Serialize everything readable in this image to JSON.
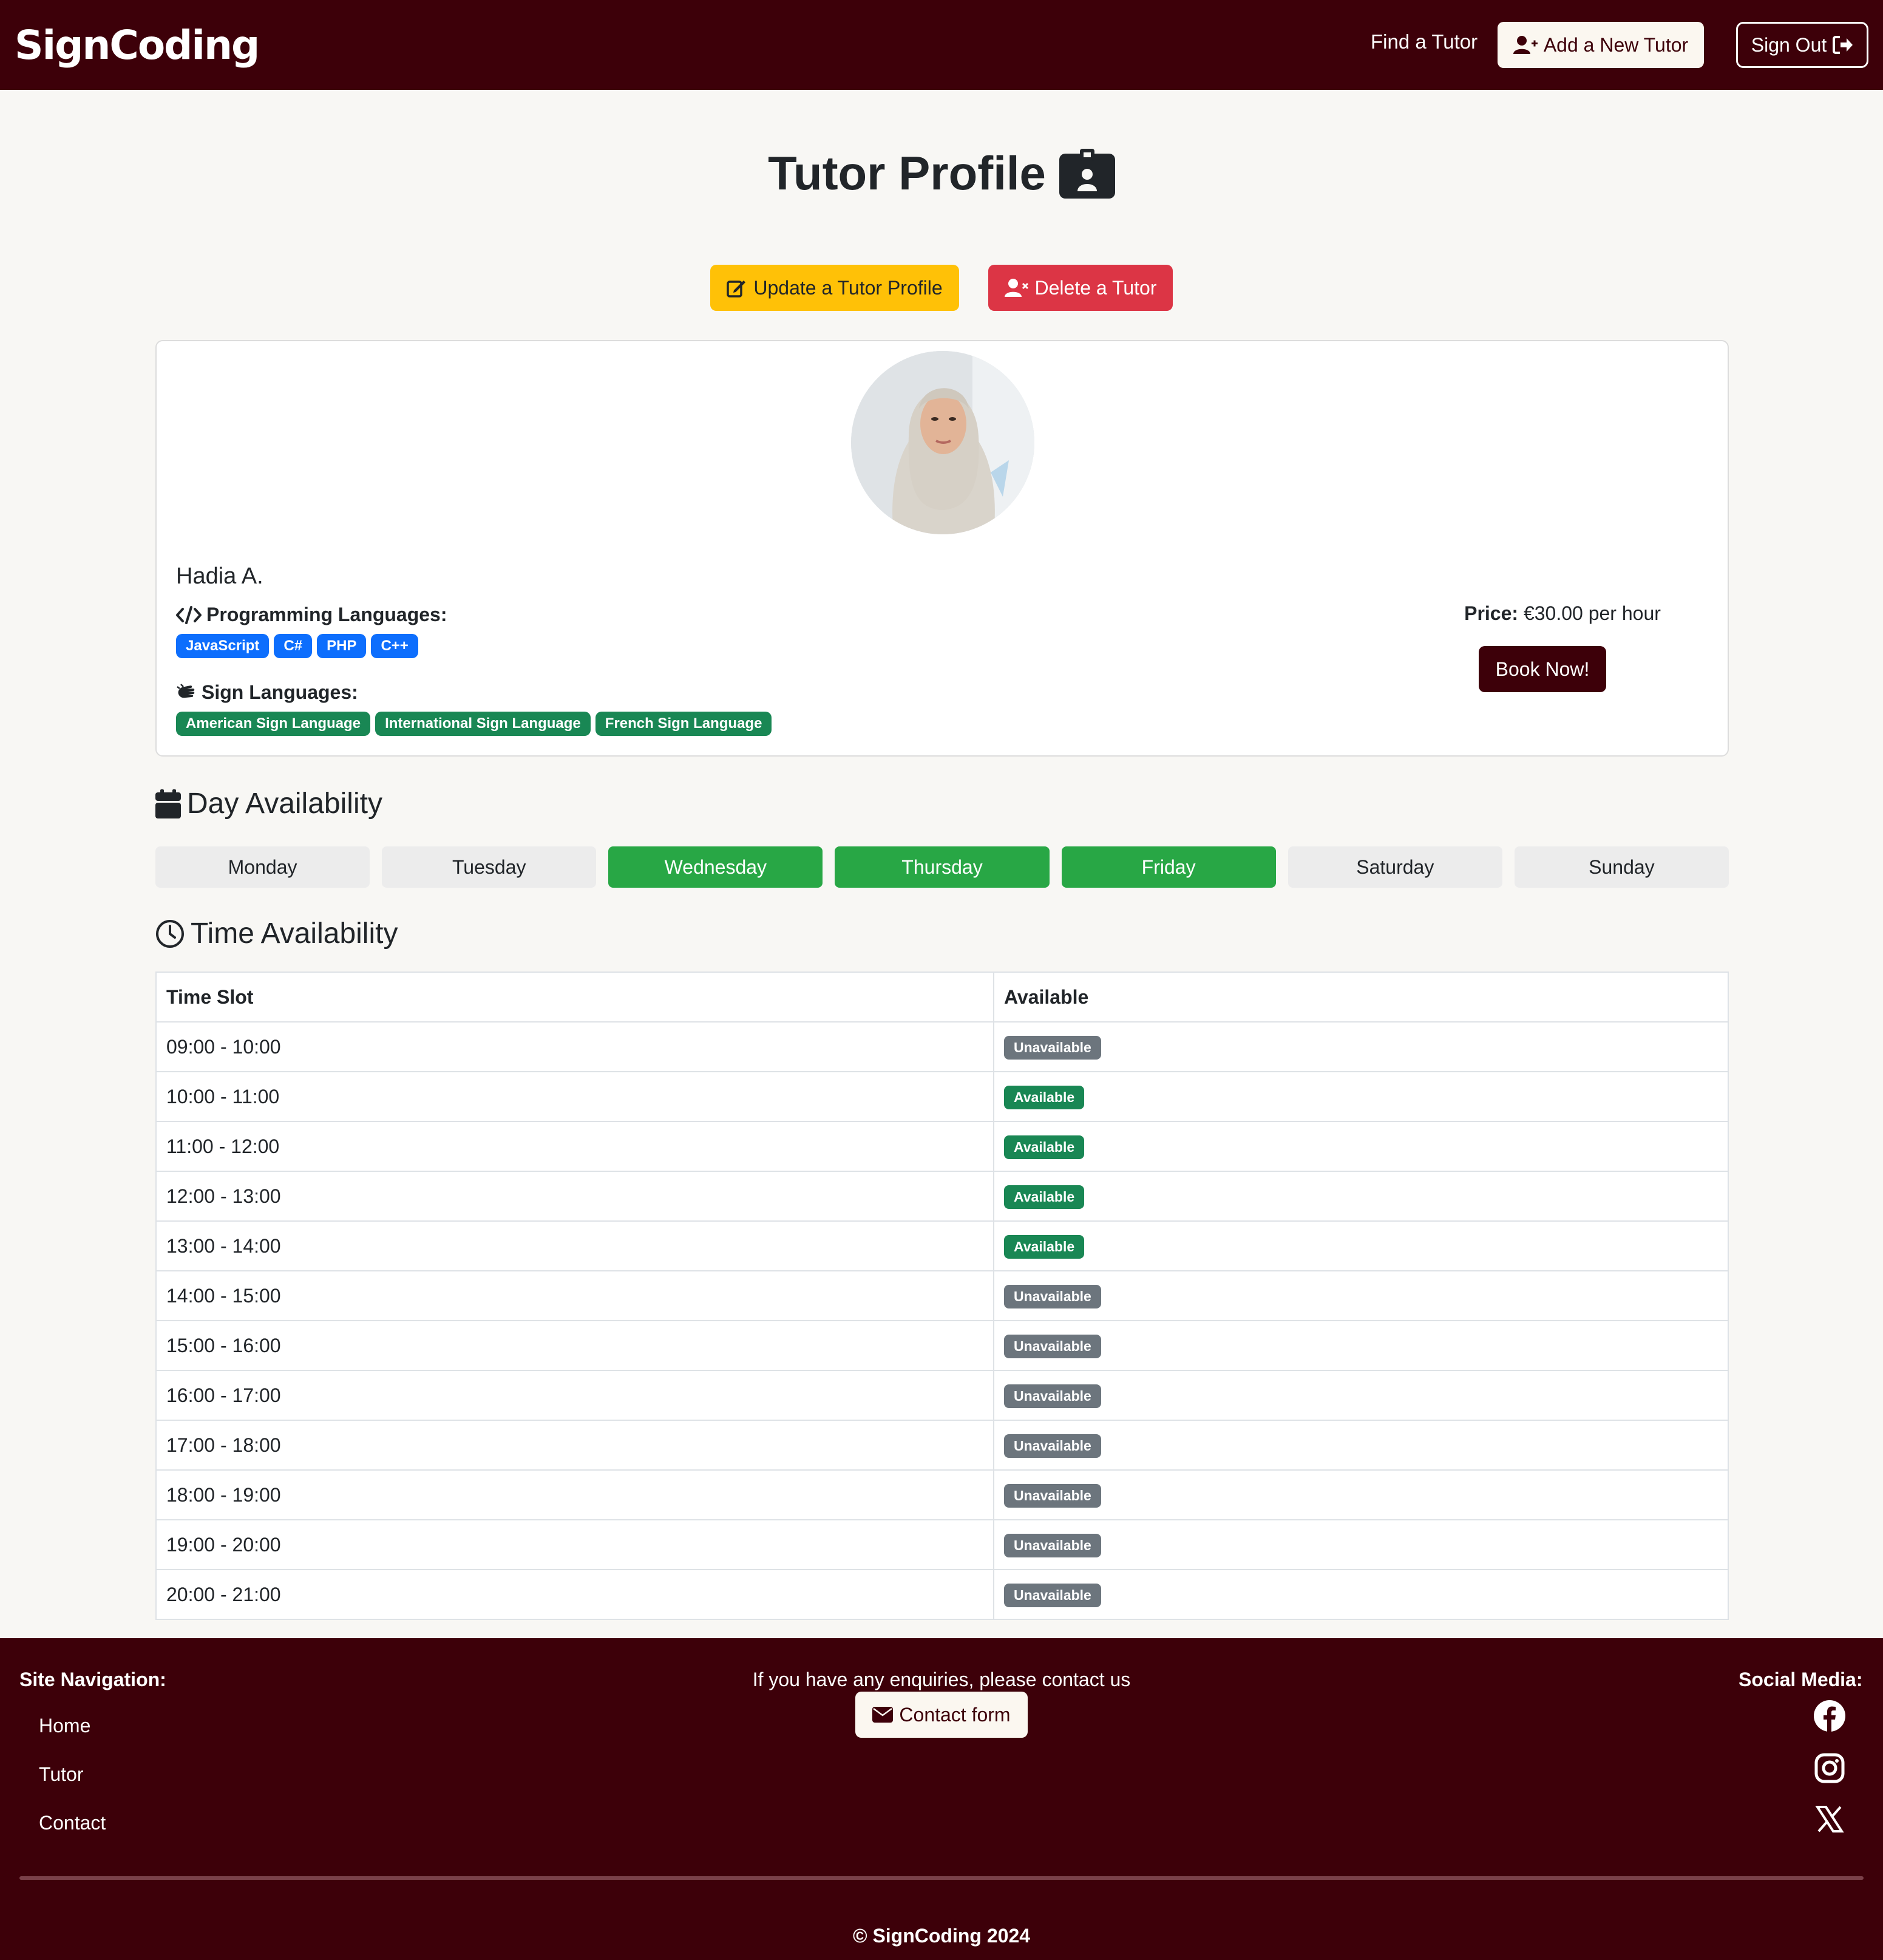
{
  "header": {
    "brand": "SignCoding",
    "find_tutor": "Find a Tutor",
    "add_tutor": "Add a New Tutor",
    "sign_out": "Sign Out"
  },
  "page": {
    "title": "Tutor Profile",
    "update_button": "Update a Tutor Profile",
    "delete_button": "Delete a Tutor"
  },
  "tutor": {
    "name": "Hadia A.",
    "programming_label": "Programming Languages:",
    "programming_languages": [
      "JavaScript",
      "C#",
      "PHP",
      "C++"
    ],
    "sign_label": "Sign Languages:",
    "sign_languages": [
      "American Sign Language",
      "International Sign Language",
      "French Sign Language"
    ],
    "price_label": "Price:",
    "price_value": "€30.00 per hour",
    "book_button": "Book Now!"
  },
  "day_availability": {
    "heading": "Day Availability",
    "days": [
      {
        "label": "Monday",
        "available": false
      },
      {
        "label": "Tuesday",
        "available": false
      },
      {
        "label": "Wednesday",
        "available": true
      },
      {
        "label": "Thursday",
        "available": true
      },
      {
        "label": "Friday",
        "available": true
      },
      {
        "label": "Saturday",
        "available": false
      },
      {
        "label": "Sunday",
        "available": false
      }
    ]
  },
  "time_availability": {
    "heading": "Time Availability",
    "columns": [
      "Time Slot",
      "Available"
    ],
    "rows": [
      {
        "slot": "09:00 - 10:00",
        "status": "Unavailable"
      },
      {
        "slot": "10:00 - 11:00",
        "status": "Available"
      },
      {
        "slot": "11:00 - 12:00",
        "status": "Available"
      },
      {
        "slot": "12:00 - 13:00",
        "status": "Available"
      },
      {
        "slot": "13:00 - 14:00",
        "status": "Available"
      },
      {
        "slot": "14:00 - 15:00",
        "status": "Unavailable"
      },
      {
        "slot": "15:00 - 16:00",
        "status": "Unavailable"
      },
      {
        "slot": "16:00 - 17:00",
        "status": "Unavailable"
      },
      {
        "slot": "17:00 - 18:00",
        "status": "Unavailable"
      },
      {
        "slot": "18:00 - 19:00",
        "status": "Unavailable"
      },
      {
        "slot": "19:00 - 20:00",
        "status": "Unavailable"
      },
      {
        "slot": "20:00 - 21:00",
        "status": "Unavailable"
      }
    ]
  },
  "footer": {
    "nav_heading": "Site Navigation:",
    "nav_links": [
      "Home",
      "Tutor",
      "Contact"
    ],
    "enquiry_text": "If you have any enquiries, please contact us",
    "contact_button": "Contact form",
    "social_heading": "Social Media:",
    "social_icons": [
      "facebook-icon",
      "instagram-icon",
      "x-icon"
    ],
    "copyright": "© SignCoding 2024"
  },
  "colors": {
    "brand": "#3d0009",
    "warning": "#ffc107",
    "danger": "#dc3545",
    "success": "#28a745",
    "badge_blue": "#0d6efd",
    "badge_green": "#198754",
    "badge_gray": "#6c757d"
  }
}
